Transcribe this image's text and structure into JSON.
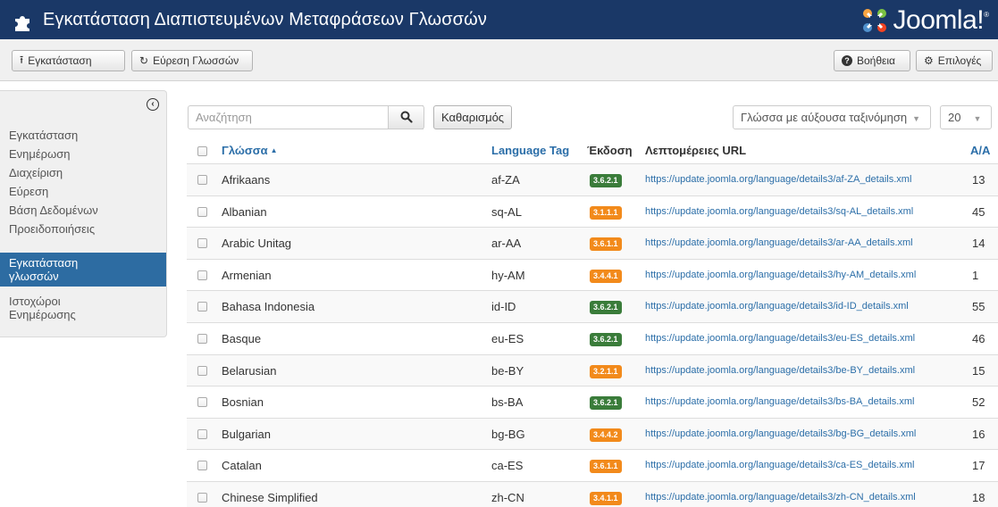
{
  "header": {
    "title": "Εγκατάσταση Διαπιστευμένων Μεταφράσεων Γλωσσών",
    "logo_text": "Joomla!",
    "logo_reg": "®"
  },
  "toolbar": {
    "install_label": "Εγκατάσταση",
    "find_label": "Εύρεση Γλωσσών",
    "help_label": "Βοήθεια",
    "options_label": "Επιλογές"
  },
  "sidebar": {
    "items": [
      {
        "label": "Εγκατάσταση"
      },
      {
        "label": "Ενημέρωση"
      },
      {
        "label": "Διαχείριση"
      },
      {
        "label": "Εύρεση"
      },
      {
        "label": "Βάση Δεδομένων"
      },
      {
        "label": "Προειδοποιήσεις"
      },
      {
        "label_line1": "Εγκατάσταση",
        "label_line2": "γλωσσών",
        "active": true
      },
      {
        "label_line1": "Ιστοχώροι",
        "label_line2": "Ενημέρωσης"
      }
    ]
  },
  "filters": {
    "search_placeholder": "Αναζήτηση",
    "clear_label": "Καθαρισμός",
    "sort_value": "Γλώσσα με αύξουσα ταξινόμηση",
    "limit_value": "20"
  },
  "table": {
    "columns": {
      "language": "Γλώσσα",
      "sort_indicator": "▲",
      "tag": "Language Tag",
      "version": "Έκδοση",
      "details": "Λεπτομέρειες URL",
      "id": "A/A"
    },
    "version_colors": {
      "current": "#3a7c3a",
      "outdated": "#f28a1b"
    },
    "rows": [
      {
        "language": "Afrikaans",
        "tag": "af-ZA",
        "version": "3.6.2.1",
        "status": "current",
        "url": "https://update.joomla.org/language/details3/af-ZA_details.xml",
        "id": "13"
      },
      {
        "language": "Albanian",
        "tag": "sq-AL",
        "version": "3.1.1.1",
        "status": "outdated",
        "url": "https://update.joomla.org/language/details3/sq-AL_details.xml",
        "id": "45"
      },
      {
        "language": "Arabic Unitag",
        "tag": "ar-AA",
        "version": "3.6.1.1",
        "status": "outdated",
        "url": "https://update.joomla.org/language/details3/ar-AA_details.xml",
        "id": "14"
      },
      {
        "language": "Armenian",
        "tag": "hy-AM",
        "version": "3.4.4.1",
        "status": "outdated",
        "url": "https://update.joomla.org/language/details3/hy-AM_details.xml",
        "id": "1"
      },
      {
        "language": "Bahasa Indonesia",
        "tag": "id-ID",
        "version": "3.6.2.1",
        "status": "current",
        "url": "https://update.joomla.org/language/details3/id-ID_details.xml",
        "id": "55"
      },
      {
        "language": "Basque",
        "tag": "eu-ES",
        "version": "3.6.2.1",
        "status": "current",
        "url": "https://update.joomla.org/language/details3/eu-ES_details.xml",
        "id": "46"
      },
      {
        "language": "Belarusian",
        "tag": "be-BY",
        "version": "3.2.1.1",
        "status": "outdated",
        "url": "https://update.joomla.org/language/details3/be-BY_details.xml",
        "id": "15"
      },
      {
        "language": "Bosnian",
        "tag": "bs-BA",
        "version": "3.6.2.1",
        "status": "current",
        "url": "https://update.joomla.org/language/details3/bs-BA_details.xml",
        "id": "52"
      },
      {
        "language": "Bulgarian",
        "tag": "bg-BG",
        "version": "3.4.4.2",
        "status": "outdated",
        "url": "https://update.joomla.org/language/details3/bg-BG_details.xml",
        "id": "16"
      },
      {
        "language": "Catalan",
        "tag": "ca-ES",
        "version": "3.6.1.1",
        "status": "outdated",
        "url": "https://update.joomla.org/language/details3/ca-ES_details.xml",
        "id": "17"
      },
      {
        "language": "Chinese Simplified",
        "tag": "zh-CN",
        "version": "3.4.1.1",
        "status": "outdated",
        "url": "https://update.joomla.org/language/details3/zh-CN_details.xml",
        "id": "18"
      }
    ]
  }
}
